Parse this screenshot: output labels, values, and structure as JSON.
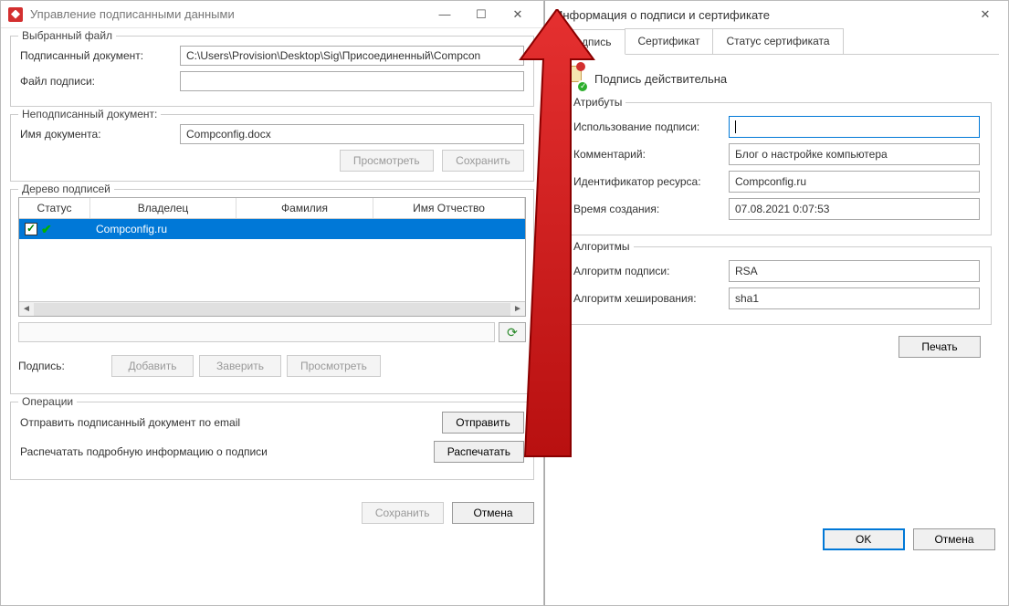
{
  "left": {
    "title": "Управление подписанными данными",
    "selected_file_label": "Выбранный файл",
    "signed_doc_label": "Подписанный документ:",
    "signed_doc_value": "C:\\Users\\Provision\\Desktop\\Sig\\Присоединенный\\Compcon",
    "sig_file_label": "Файл подписи:",
    "sig_file_value": "",
    "unsigned_label": "Неподписанный документ:",
    "doc_name_label": "Имя документа:",
    "doc_name_value": "Compconfig.docx",
    "btn_view": "Просмотреть",
    "btn_save": "Сохранить",
    "tree_label": "Дерево подписей",
    "grid": {
      "cols": [
        "Статус",
        "Владелец",
        "Фамилия",
        "Имя Отчество"
      ],
      "row_owner": "Compconfig.ru"
    },
    "sig_inline_label": "Подпись:",
    "btn_add": "Добавить",
    "btn_cert": "Заверить",
    "btn_view2": "Просмотреть",
    "ops_label": "Операции",
    "op_email": "Отправить подписанный документ по email",
    "btn_send": "Отправить",
    "op_print": "Распечатать подробную информацию о подписи",
    "btn_print": "Распечатать",
    "btn_save2": "Сохранить",
    "btn_cancel": "Отмена"
  },
  "right": {
    "title": "Информация о подписи и сертификате",
    "tabs": [
      "Подпись",
      "Сертификат",
      "Статус сертификата"
    ],
    "status_text": "Подпись действительна",
    "attrs_label": "Атрибуты",
    "usage_label": "Использование подписи:",
    "usage_value": "",
    "comment_label": "Комментарий:",
    "comment_value": "Блог о настройке компьютера",
    "resid_label": "Идентификатор ресурса:",
    "resid_value": "Compconfig.ru",
    "time_label": "Время создания:",
    "time_value": "07.08.2021 0:07:53",
    "algs_label": "Алгоритмы",
    "sigalg_label": "Алгоритм подписи:",
    "sigalg_value": "RSA",
    "hashalg_label": "Алгоритм хеширования:",
    "hashalg_value": "sha1",
    "btn_print": "Печать",
    "btn_ok": "OK",
    "btn_cancel": "Отмена"
  }
}
